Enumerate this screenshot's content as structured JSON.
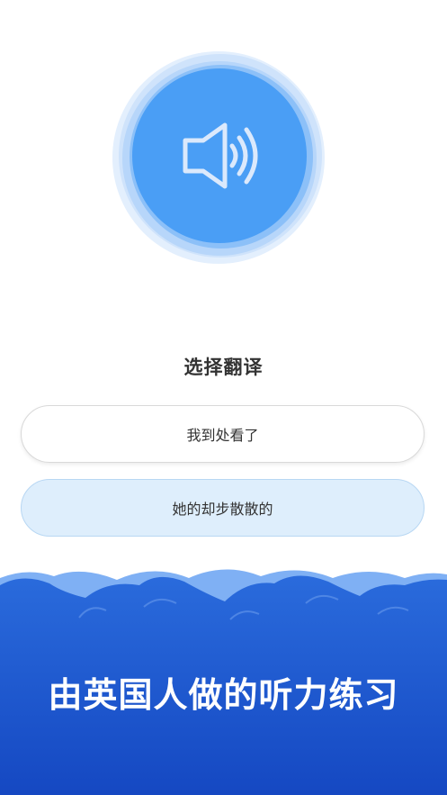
{
  "speaker": {
    "icon": "speaker-volume-icon"
  },
  "question": {
    "title": "选择翻译"
  },
  "options": [
    {
      "label": "我到处看了"
    },
    {
      "label": "她的却步散散的"
    }
  ],
  "banner": {
    "text": "由英国人做的听力练习"
  },
  "colors": {
    "primary_blue": "#4a9ef5",
    "banner_blue": "#1f5fd6",
    "selected_option_bg": "#deeefc"
  }
}
